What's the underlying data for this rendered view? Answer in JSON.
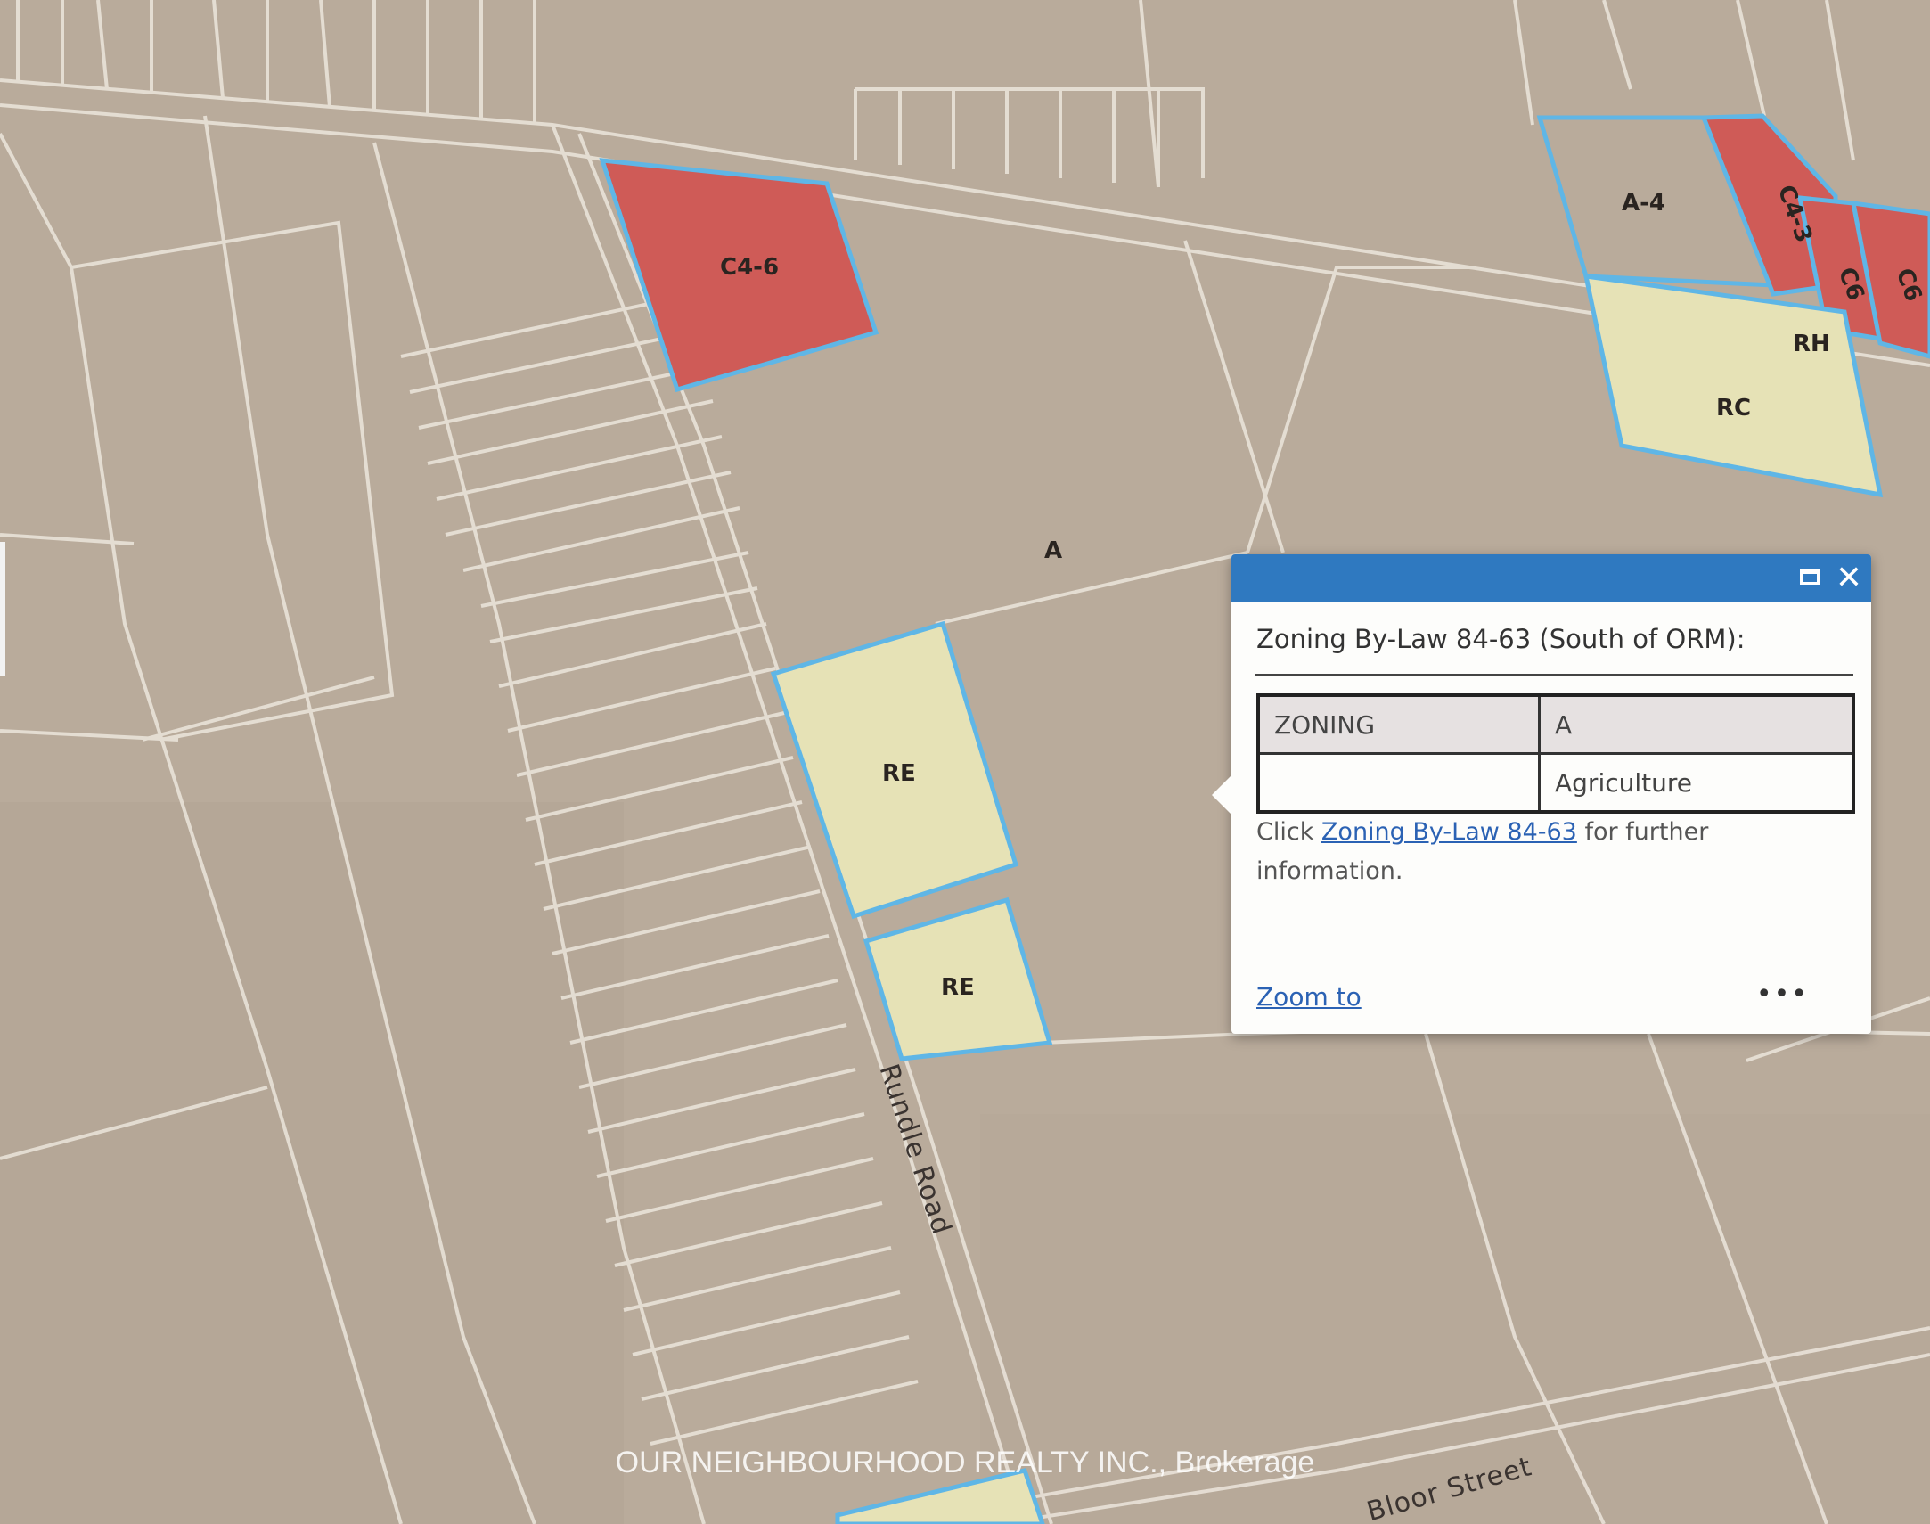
{
  "colors": {
    "base": "#b9ab9b",
    "parcel_line": "#ece6dc",
    "zone_outline": "#5fb6e6",
    "commercial_fill": "#cf5b57",
    "residential_fill": "#e6e2b6",
    "popup_header": "#2f79c0",
    "link": "#2b62b4"
  },
  "map": {
    "zone_labels": {
      "c4_6": "C4-6",
      "a4": "A-4",
      "c4_3": "C4-3",
      "c6_a": "C6",
      "c6_b": "C6",
      "rh": "RH",
      "rc": "RC",
      "a": "A",
      "re_1": "RE",
      "re_2": "RE"
    },
    "roads": {
      "rundle": "Rundle Road",
      "bloor": "Bloor Street"
    }
  },
  "popup": {
    "title": "Zoning By-Law 84-63 (South of ORM):",
    "table": {
      "row1_key": "ZONING",
      "row1_value": "A",
      "row2_key": "",
      "row2_value": "Agriculture"
    },
    "note_prefix": "Click ",
    "note_link": "Zoning By-Law 84-63",
    "note_suffix": " for further information.",
    "zoom_link": "Zoom to",
    "more": "•••"
  },
  "watermark": "OUR NEIGHBOURHOOD REALTY INC., Brokerage"
}
